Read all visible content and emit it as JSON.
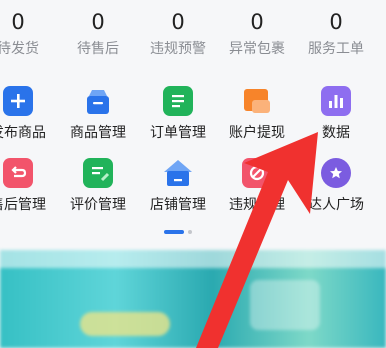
{
  "stats": [
    {
      "value": "0",
      "label": "待发货"
    },
    {
      "value": "0",
      "label": "待售后"
    },
    {
      "value": "0",
      "label": "违规预警"
    },
    {
      "value": "0",
      "label": "异常包裹"
    },
    {
      "value": "0",
      "label": "服务工单"
    }
  ],
  "menu_row1": [
    {
      "label": "发布商品",
      "icon": "plus-icon",
      "color": "#2a73ea"
    },
    {
      "label": "商品管理",
      "icon": "shopping-bag-icon",
      "color": "#2a73ea"
    },
    {
      "label": "订单管理",
      "icon": "order-list-icon",
      "color": "#21b35a"
    },
    {
      "label": "账户提现",
      "icon": "wallet-icon",
      "color": "#f7842a"
    },
    {
      "label": "数据",
      "icon": "bar-chart-icon",
      "color": "#7b5ce0"
    }
  ],
  "menu_row2": [
    {
      "label": "售后管理",
      "icon": "return-icon",
      "color": "#f2546b"
    },
    {
      "label": "评价管理",
      "icon": "review-icon",
      "color": "#21b35a"
    },
    {
      "label": "店铺管理",
      "icon": "store-icon",
      "color": "#2a73ea"
    },
    {
      "label": "违规管理",
      "icon": "violation-icon",
      "color": "#f2546b"
    },
    {
      "label": "达人广场",
      "icon": "star-badge-icon",
      "color": "#7b5ce0"
    }
  ],
  "pager": {
    "pages": 2,
    "current": 1
  },
  "annotation": {
    "arrow_color": "#f0312f"
  }
}
